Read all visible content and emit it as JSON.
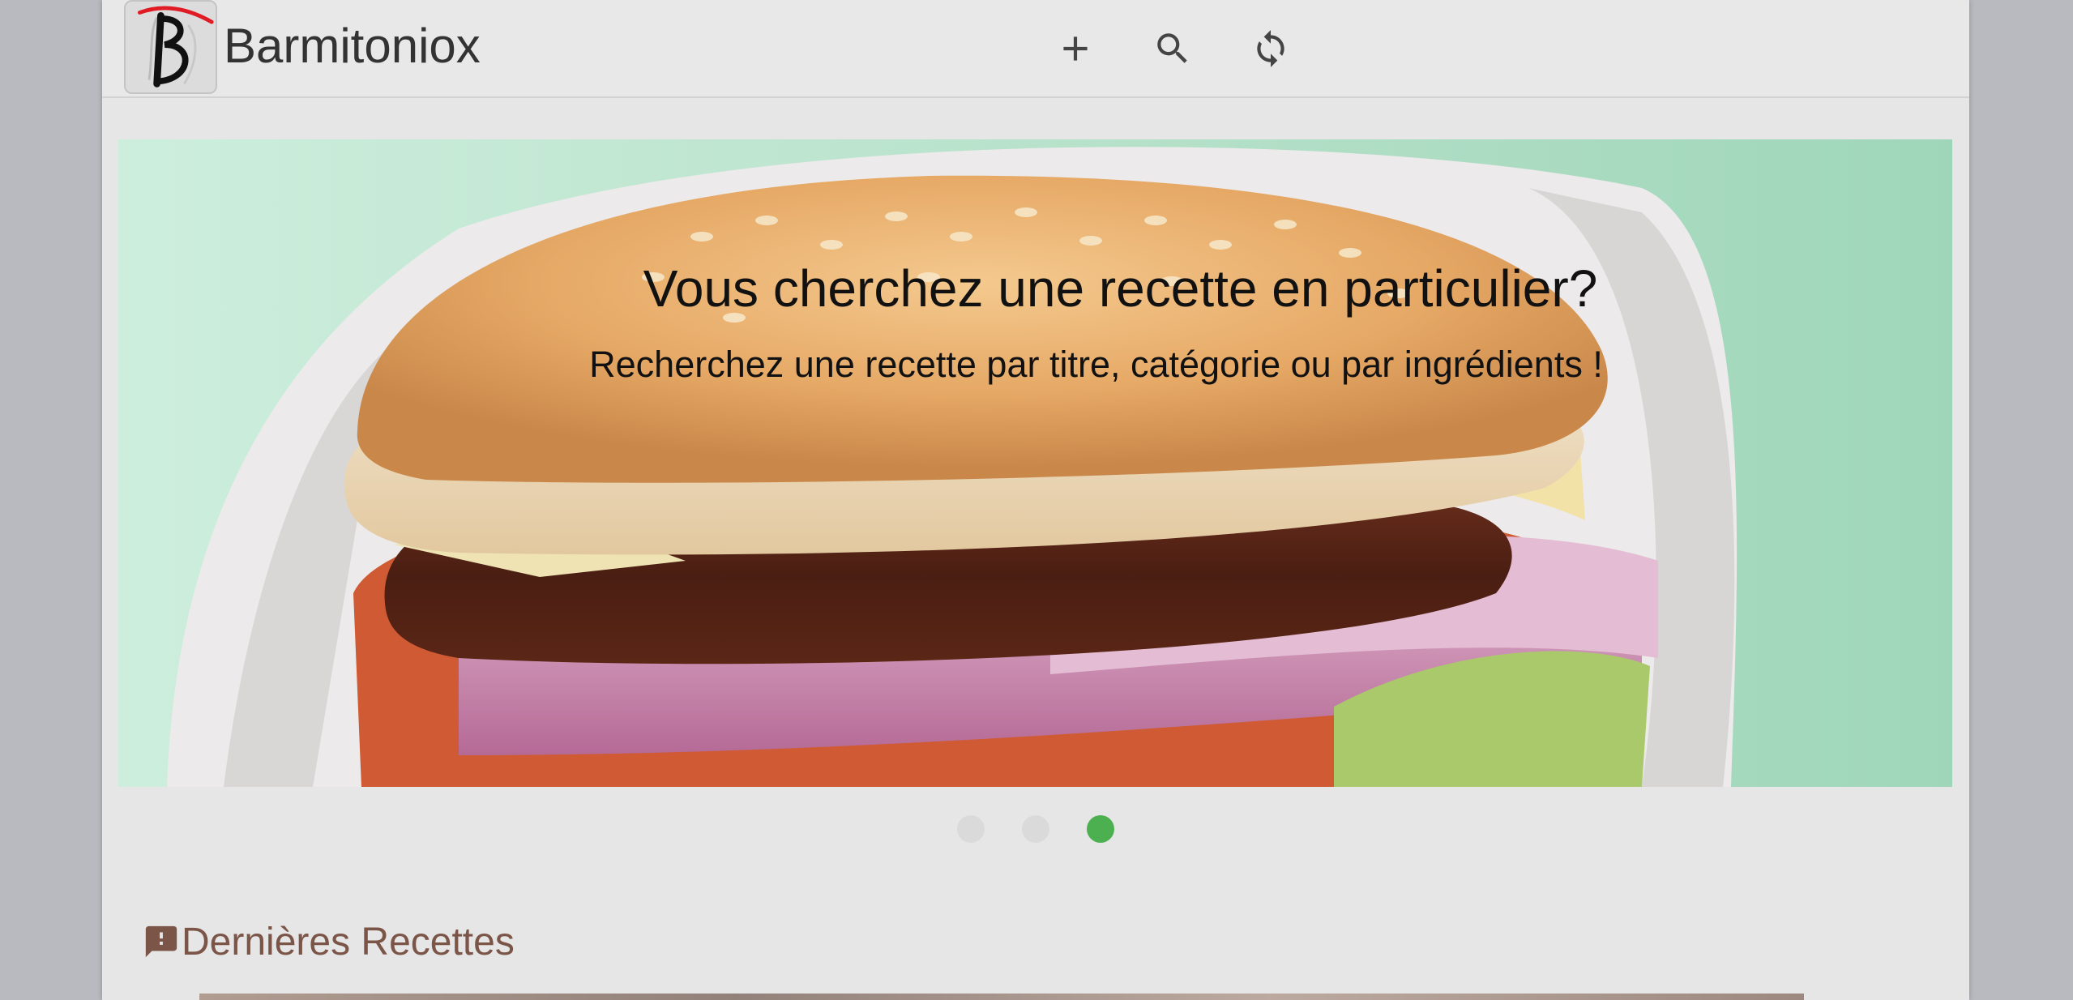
{
  "header": {
    "app_title": "Barmitoniox",
    "logo_name": "barmitoniox-logo"
  },
  "toolbar": {
    "add_icon": "plus-icon",
    "search_icon": "search-icon",
    "refresh_icon": "refresh-icon"
  },
  "hero": {
    "title": "Vous cherchez une recette en particulier?",
    "subtitle": "Recherchez une recette par titre, catégorie ou par ingrédients !"
  },
  "carousel": {
    "total": 3,
    "active_index": 2,
    "active_color": "#4caf50",
    "inactive_color": "#dadada"
  },
  "sections": {
    "latest_title": "Dernières Recettes",
    "latest_icon": "feedback-icon"
  },
  "colors": {
    "accent": "#4caf50",
    "section_title": "#7b5548",
    "background": "#e6e6e6"
  }
}
